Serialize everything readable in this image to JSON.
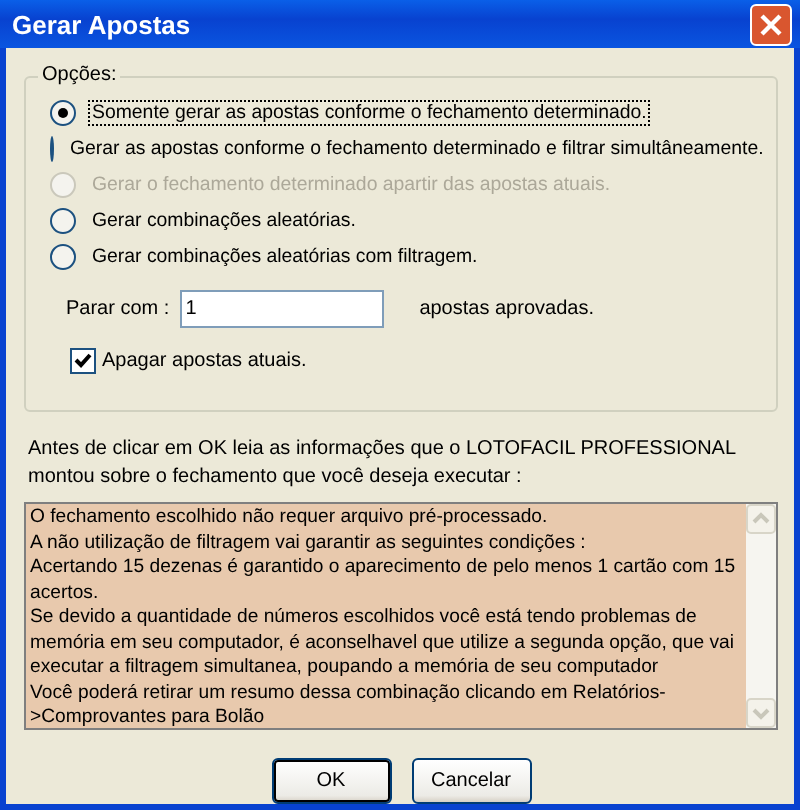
{
  "window": {
    "title": "Gerar Apostas"
  },
  "options": {
    "legend": "Opções:",
    "radios": [
      {
        "label": "Somente gerar as apostas conforme o fechamento determinado.",
        "selected": true,
        "disabled": false,
        "focused": true
      },
      {
        "label": "Gerar as apostas conforme o fechamento determinado e filtrar simultâneamente.",
        "selected": false,
        "disabled": false,
        "focused": false
      },
      {
        "label": "Gerar o fechamento determinado apartir das apostas atuais.",
        "selected": false,
        "disabled": true,
        "focused": false
      },
      {
        "label": "Gerar combinações aleatórias.",
        "selected": false,
        "disabled": false,
        "focused": false
      },
      {
        "label": "Gerar combinações aleatórias com filtragem.",
        "selected": false,
        "disabled": false,
        "focused": false
      }
    ],
    "stop": {
      "label": "Parar com :",
      "value": "1",
      "suffix": "apostas aprovadas."
    },
    "checkbox": {
      "label": "Apagar apostas atuais.",
      "checked": true
    }
  },
  "info": "Antes de clicar em OK leia as informações que o LOTOFACIL PROFESSIONAL montou sobre o fechamento  que você deseja  executar :",
  "memo": [
    "O fechamento escolhido não requer arquivo pré-processado.",
    "A não utilização de filtragem vai garantir as seguintes condições :",
    "Acertando 15 dezenas é garantido o aparecimento de pelo menos 1 cartão com 15 acertos.",
    "Se devido a quantidade  de números escolhidos você está tendo problemas de memória em seu computador, é aconselhavel que utilize a segunda opção, que vai executar a filtragem simultanea, poupando a memória de seu computador",
    "Você poderá retirar um resumo dessa combinação clicando em Relatórios->Comprovantes para Bolão"
  ],
  "buttons": [
    {
      "label": "OK",
      "default": true
    },
    {
      "label": "Cancelar",
      "default": false
    }
  ]
}
